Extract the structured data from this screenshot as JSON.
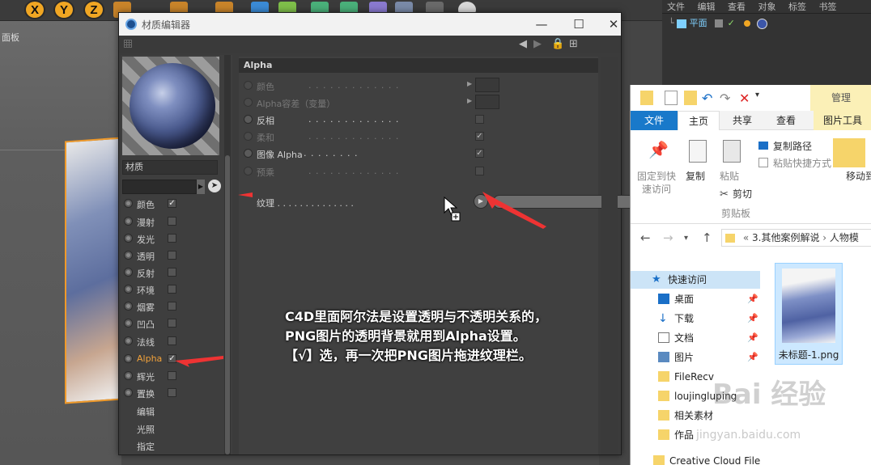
{
  "c4d": {
    "toolbar": {
      "axes": [
        "X",
        "Y",
        "Z"
      ]
    },
    "viewport": {
      "label": "面板"
    },
    "object_manager": {
      "menu": [
        "文件",
        "编辑",
        "查看",
        "对象",
        "标签",
        "书签"
      ],
      "object_name": "平面"
    }
  },
  "material_editor": {
    "title": "材质编辑器",
    "controls": {
      "minimize": "—",
      "maximize": "☐",
      "close": "✕"
    },
    "material_name": "材质",
    "channels": [
      {
        "label": "颜色",
        "checked": true
      },
      {
        "label": "漫射",
        "checked": false
      },
      {
        "label": "发光",
        "checked": false
      },
      {
        "label": "透明",
        "checked": false
      },
      {
        "label": "反射",
        "checked": false
      },
      {
        "label": "环境",
        "checked": false
      },
      {
        "label": "烟雾",
        "checked": false
      },
      {
        "label": "凹凸",
        "checked": false
      },
      {
        "label": "法线",
        "checked": false
      },
      {
        "label": "Alpha",
        "checked": true
      },
      {
        "label": "辉光",
        "checked": false
      },
      {
        "label": "置换",
        "checked": false
      }
    ],
    "extra_items": [
      "编辑",
      "光照",
      "指定"
    ],
    "section_header": "Alpha",
    "properties": [
      {
        "label": "颜色",
        "dots": ". . . . . . . . . . . . .",
        "type": "swatch"
      },
      {
        "label": "Alpha容差（变量）",
        "dots": "",
        "type": "swatch"
      },
      {
        "label": "反相",
        "dots": ". . . . . . . . . . . . .",
        "type": "check",
        "value": ""
      },
      {
        "label": "柔和",
        "dots": ". . . . . . . . . . . . .",
        "type": "check",
        "value": "✓"
      },
      {
        "label": "图像 Alpha",
        "dots": ". . . . . . . .",
        "type": "check",
        "value": "✓"
      },
      {
        "label": "预乘",
        "dots": ". . . . . . . . . . . . .",
        "type": "check",
        "value": ""
      }
    ],
    "texture": {
      "label": "纹理",
      "dots": ". . . . . . . . . . . . . .",
      "more": "..."
    }
  },
  "caption": [
    "C4D里面阿尔法是设置透明与不透明关系的，",
    "PNG图片的透明背景就用到Alpha设置。",
    "【√】选，再一次把PNG图片拖进纹理栏。"
  ],
  "explorer": {
    "manage_tab": "管理",
    "tabs": {
      "file": "文件",
      "home": "主页",
      "share": "共享",
      "view": "查看",
      "picture_tools": "图片工具"
    },
    "ribbon": {
      "pin_quick": "固定到快",
      "pin_quick2": "速访问",
      "copy": "复制",
      "paste": "粘贴",
      "copy_path": "复制路径",
      "paste_shortcut": "粘贴快捷方式",
      "cut": "剪切",
      "clipboard": "剪贴板",
      "move_to": "移动到"
    },
    "address": {
      "sep": "«",
      "path1": "3.其他案例解说",
      "arrow": "›",
      "path2": "人物模"
    },
    "nav": {
      "quick_access": "快速访问",
      "items": [
        "桌面",
        "下载",
        "文档",
        "图片",
        "FileRecv",
        "loujingluping",
        "相关素材",
        "作品",
        "Creative Cloud Files"
      ]
    },
    "file": {
      "name": "未标题-1.png"
    }
  },
  "watermark": {
    "brand": "Bai 经验",
    "url": "jingyan.baidu.com"
  }
}
